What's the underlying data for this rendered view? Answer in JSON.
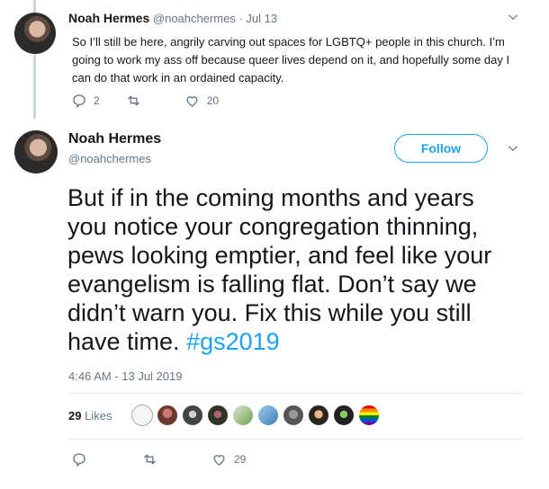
{
  "tweet_parent": {
    "name": "Noah Hermes",
    "handle": "@noahchermes",
    "date": "· Jul 13",
    "text": "So I’ll still be here, angrily carving out spaces for LGBTQ+ people in this church. I’m going to work my ass off because queer lives depend on it, and hopefully some day I can do that work in an ordained capacity.",
    "replies": "2",
    "likes": "20"
  },
  "tweet_main": {
    "name": "Noah Hermes",
    "handle": "@noahchermes",
    "follow_label": "Follow",
    "text": "But if in the coming months and years you notice your congregation thinning, pews looking emptier, and feel like your evangelism is falling flat. Don’t say we didn’t warn you. Fix this while you still have time. ",
    "hashtag": "#gs2019",
    "timestamp": "4:46 AM - 13 Jul 2019",
    "likes_count": "29",
    "likes_label": "Likes",
    "action_likes": "29"
  },
  "colors": {
    "accent": "#1da1f2",
    "muted": "#657786",
    "text": "#14171a"
  },
  "icons": [
    "reply-icon",
    "retweet-icon",
    "heart-icon",
    "chevron-down-icon"
  ]
}
